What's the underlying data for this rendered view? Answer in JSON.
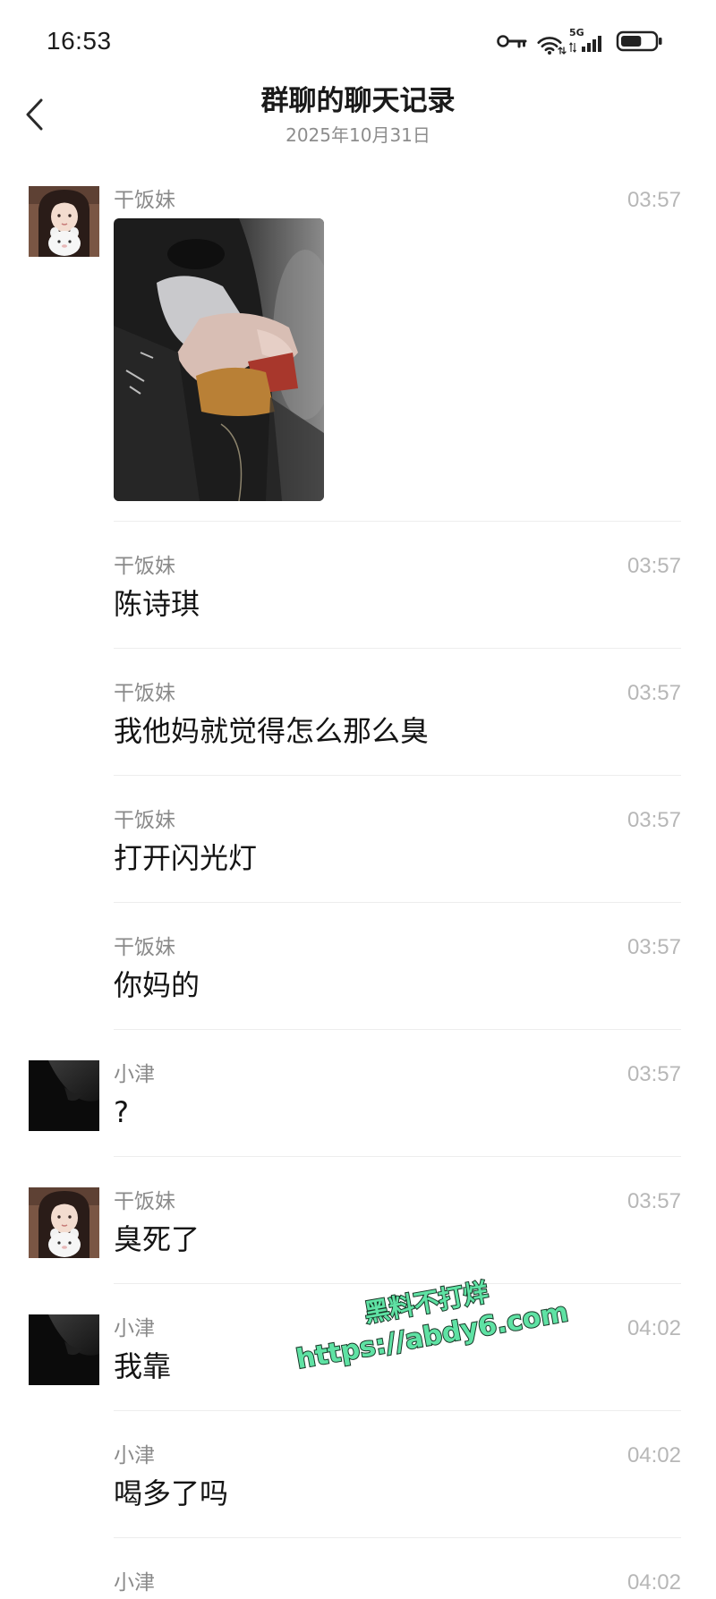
{
  "status_bar": {
    "time": "16:53",
    "network": "5G",
    "battery_level": 0.62,
    "icons": [
      "vpn-key-icon",
      "wifi-icon",
      "cellular-signal-icon",
      "battery-icon"
    ]
  },
  "header": {
    "back_icon": "chevron-left-icon",
    "title": "群聊的聊天记录",
    "date": "2025年10月31日"
  },
  "messages": [
    {
      "sender": "干饭妹",
      "time": "03:57",
      "image": true,
      "avatar_icon": "girl-avatar"
    },
    {
      "sender": "干饭妹",
      "time": "03:57",
      "text": "陈诗琪"
    },
    {
      "sender": "干饭妹",
      "time": "03:57",
      "text": "我他妈就觉得怎么那么臭"
    },
    {
      "sender": "干饭妹",
      "time": "03:57",
      "text": "打开闪光灯"
    },
    {
      "sender": "干饭妹",
      "time": "03:57",
      "text": "你妈的"
    },
    {
      "sender": "小津",
      "time": "03:57",
      "text": "?",
      "avatar_icon": "dark-avatar"
    },
    {
      "sender": "干饭妹",
      "time": "03:57",
      "text": "臭死了",
      "avatar_icon": "girl-avatar"
    },
    {
      "sender": "小津",
      "time": "04:02",
      "text": "我靠",
      "avatar_icon": "dark-avatar"
    },
    {
      "sender": "小津",
      "time": "04:02",
      "text": "喝多了吗"
    },
    {
      "sender": "小津",
      "time": "04:02"
    }
  ],
  "watermark": {
    "line1": "黑料不打烊",
    "line2": "https://abdy6.com"
  },
  "colors": {
    "watermark": "#5fe2a4",
    "message_text": "#141414",
    "sender_name": "#8a8a8a",
    "timestamp": "#b7b7b7"
  }
}
